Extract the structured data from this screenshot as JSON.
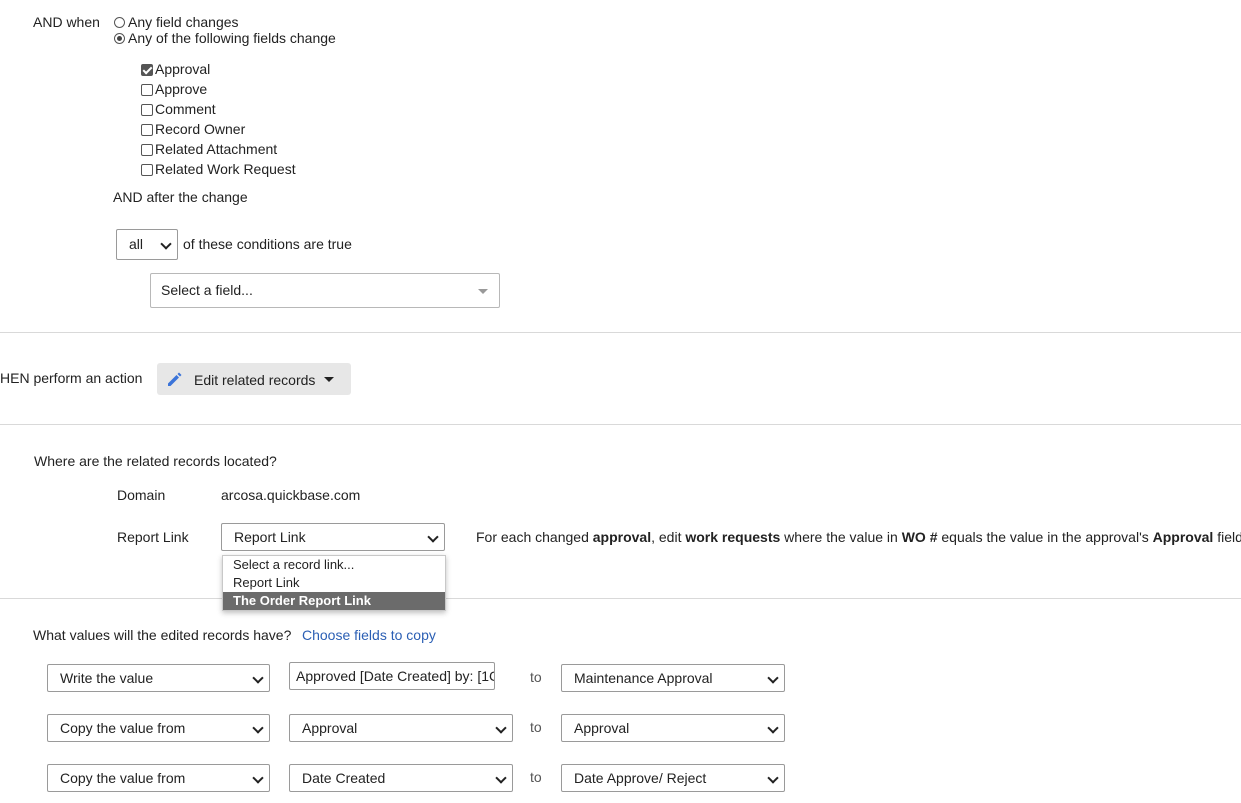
{
  "trigger": {
    "and_when_label": "AND when",
    "options": [
      {
        "label": "Any field changes",
        "selected": false
      },
      {
        "label": "Any of the following fields change",
        "selected": true
      }
    ],
    "fields": [
      {
        "label": "Approval",
        "checked": true
      },
      {
        "label": "Approve",
        "checked": false
      },
      {
        "label": "Comment",
        "checked": false
      },
      {
        "label": "Record Owner",
        "checked": false
      },
      {
        "label": "Related Attachment",
        "checked": false
      },
      {
        "label": "Related Work Request",
        "checked": false
      }
    ],
    "after_change_label": "AND after the change",
    "conditions_select": "all",
    "conditions_text": "of these conditions are true",
    "field_placeholder": "Select a field..."
  },
  "action": {
    "label": "HEN perform an action",
    "button_label": "Edit related records"
  },
  "related": {
    "question": "Where are the related records located?",
    "domain_label": "Domain",
    "domain_value": "arcosa.quickbase.com",
    "report_link_label": "Report Link",
    "report_link_value": "Report Link",
    "dropdown_options": [
      "Select a record link...",
      "Report Link",
      "The Order Report Link"
    ],
    "description": {
      "p1": "For each changed ",
      "b1": "approval",
      "p2": ", edit ",
      "b2": "work requests",
      "p3": " where the value in ",
      "b3": "WO #",
      "p4": " equals the value in the approval's ",
      "b4": "Approval",
      "p5": " field."
    }
  },
  "values": {
    "question": "What values will the edited records have?",
    "choose_link": "Choose fields to copy",
    "to_label": "to",
    "rows": [
      {
        "mode": "Write the value",
        "source": "Approved [Date Created] by: [1C",
        "target": "Maintenance Approval"
      },
      {
        "mode": "Copy the value from",
        "source": "Approval",
        "target": "Approval"
      },
      {
        "mode": "Copy the value from",
        "source": "Date Created",
        "target": "Date Approve/ Reject"
      }
    ]
  },
  "colors": {
    "link": "#2b5fb4",
    "highlight": "#6b6b6b",
    "pencil": "#3b74d9"
  }
}
